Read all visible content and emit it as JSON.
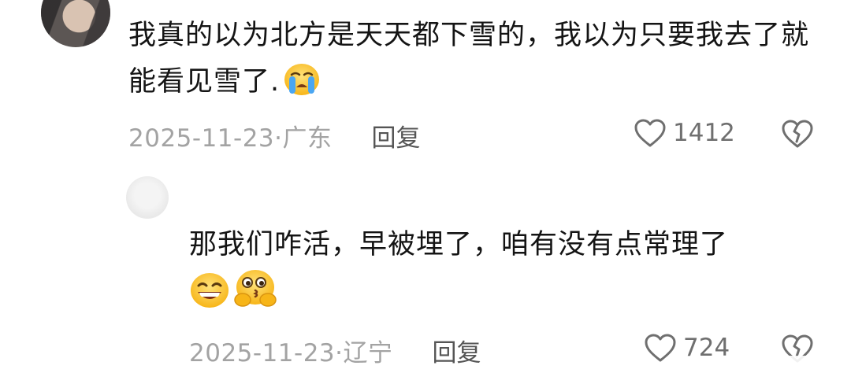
{
  "comment": {
    "text": "我真的以为北方是天天都下雪的，我以为只要我去了就能看见雪了.",
    "emoji": "crying-face-icon",
    "date": "2025-11-23·广东",
    "reply_label": "回复",
    "likes": "1412"
  },
  "reply": {
    "text": "那我们咋活，早被埋了，咱有没有点常理了",
    "emojis": [
      "grinning-face-icon",
      "thinking-kiss-face-icon"
    ],
    "date": "2025-11-23·辽宁",
    "reply_label": "回复",
    "likes": "724"
  },
  "colors": {
    "text": "#141414",
    "meta": "#a3a3a3",
    "reply_btn": "#555555",
    "icon": "#6f6f6f"
  }
}
